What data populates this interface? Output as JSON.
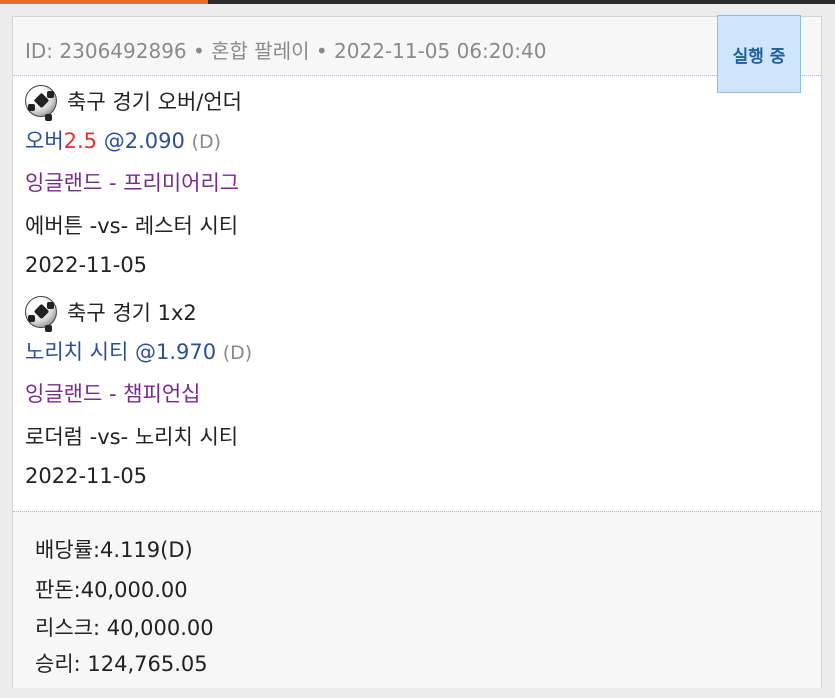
{
  "header": {
    "bet_line": "ID: 2306492896 • 혼합 팔레이 • 2022-11-05 06:20:40",
    "status": "실행 중"
  },
  "selections": [
    {
      "market": "축구 경기 오버/언더",
      "pick_prefix": "오버",
      "pick_line": "2.5",
      "pick_odds": " @2.090",
      "odds_format": "(D)",
      "league": "잉글랜드 - 프리미어리그",
      "match": "에버튼 -vs- 레스터 시티",
      "date": "2022-11-05"
    },
    {
      "market": "축구 경기 1x2",
      "pick_prefix": "노리치 시티",
      "pick_line": "",
      "pick_odds": " @1.970",
      "odds_format": "(D)",
      "league": "잉글랜드 - 챔피언십",
      "match": "로더럼 -vs- 노리치 시티",
      "date": "2022-11-05"
    }
  ],
  "summary": {
    "odds": "배당률:4.119(D)",
    "stake": "판돈:40,000.00",
    "risk": "리스크: 40,000.00",
    "win": "승리: 124,765.05"
  },
  "icons": {
    "sport": "soccer-ball-icon"
  },
  "colors": {
    "accent": "#f26a1b",
    "pick": "#2a4f9b",
    "line": "#e0312c",
    "league": "#7a2a8e",
    "status_bg": "#cfe5fb"
  }
}
